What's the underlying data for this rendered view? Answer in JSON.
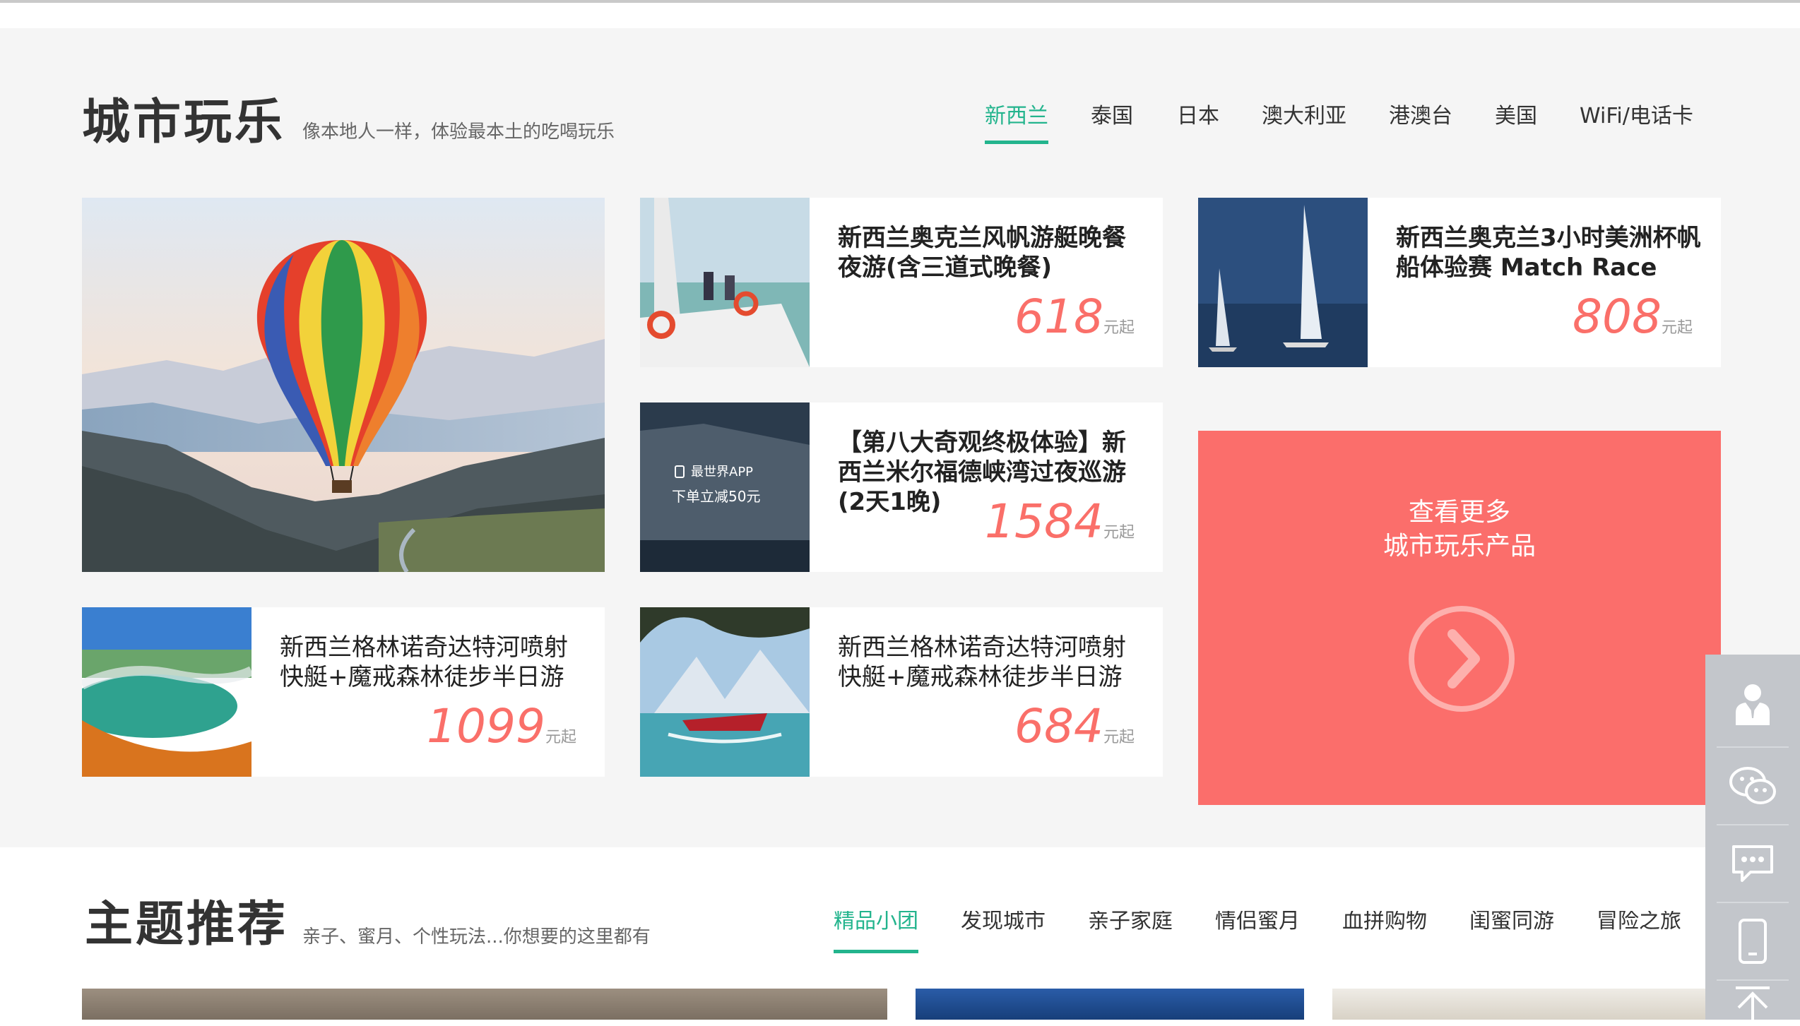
{
  "section_city": {
    "title": "城市玩乐",
    "subtitle": "像本地人一样，体验最本土的吃喝玩乐",
    "tabs": [
      "新西兰",
      "泰国",
      "日本",
      "澳大利亚",
      "港澳台",
      "美国",
      "WiFi/电话卡"
    ],
    "active_tab": "新西兰",
    "featured_image": "hot-air-balloon-over-lake",
    "cards": [
      {
        "title": "新西兰奥克兰风帆游艇晚餐夜游(含三道式晚餐)",
        "price": "618",
        "unit": "元起",
        "image": "sailboat-harbor"
      },
      {
        "title": "新西兰奥克兰3小时美洲杯帆船体验赛 Match Race",
        "price": "808",
        "unit": "元起",
        "image": "racing-yachts"
      },
      {
        "title": "【第八大奇观终极体验】新西兰米尔福德峡湾过夜巡游(2天1晚)",
        "price": "1584",
        "unit": "元起",
        "image": "milford-sound-promo",
        "promo_line1": "最世界APP",
        "promo_line2": "下单立减50元"
      },
      {
        "title": "新西兰格林诺奇达特河喷射快艇+魔戒森林徒步半日游",
        "price": "1099",
        "unit": "元起",
        "image": "thermal-pool"
      },
      {
        "title": "新西兰格林诺奇达特河喷射快艇+魔戒森林徒步半日游",
        "price": "684",
        "unit": "元起",
        "image": "jet-boat-lake"
      }
    ],
    "more": {
      "line1": "查看更多",
      "line2": "城市玩乐产品"
    }
  },
  "section_theme": {
    "title": "主题推荐",
    "subtitle": "亲子、蜜月、个性玩法...你想要的这里都有",
    "tabs": [
      "精品小团",
      "发现城市",
      "亲子家庭",
      "情侣蜜月",
      "血拼购物",
      "闺蜜同游",
      "冒险之旅"
    ],
    "active_tab": "精品小团"
  },
  "sidebar": [
    "customer-service-icon",
    "wechat-icon",
    "chat-icon",
    "mobile-icon",
    "back-to-top-icon"
  ],
  "colors": {
    "accent": "#23b48d",
    "price": "#fa6f69",
    "more_bg": "#fb6e6b",
    "sidebar_bg": "#c3c6cb",
    "section_bg": "#f5f5f5"
  }
}
